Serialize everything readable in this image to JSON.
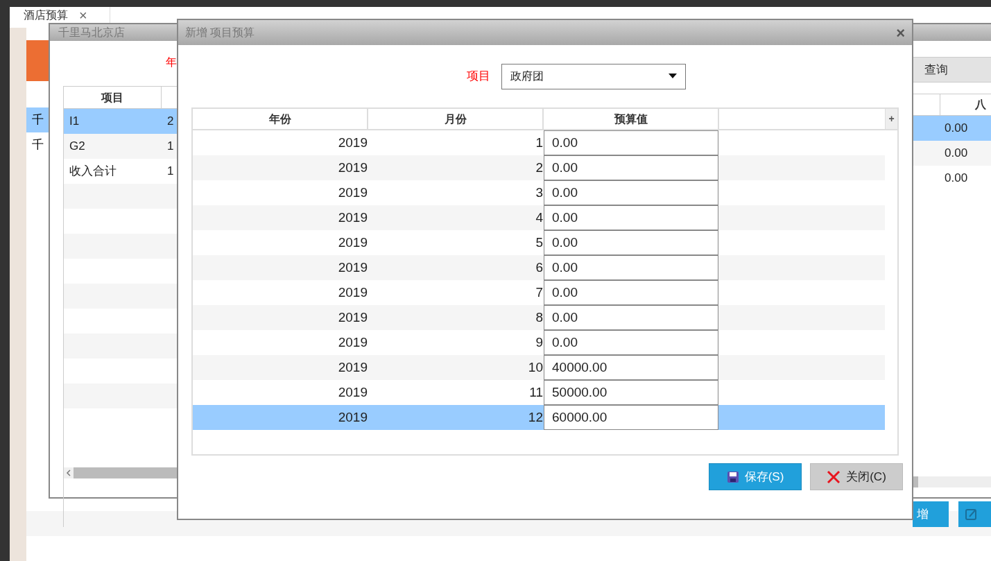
{
  "tab": {
    "label": "酒店预算",
    "close": "×"
  },
  "page": {
    "list_rows": [
      {
        "label": "千",
        "selected": true
      },
      {
        "label": "千",
        "selected": false
      }
    ]
  },
  "store_window": {
    "title": "千里马北京店",
    "year_label": "年",
    "query_button": "查询",
    "columns": [
      "项目"
    ],
    "right_column": "八",
    "rows": [
      {
        "cells": [
          "I1",
          "2"
        ],
        "right_value": "0.00",
        "selected": true
      },
      {
        "cells": [
          "G2",
          "1"
        ],
        "right_value": "0.00",
        "selected": false
      },
      {
        "cells": [
          "收入合计",
          "1"
        ],
        "right_value": "0.00",
        "selected": false
      }
    ],
    "add_button": "增"
  },
  "dialog": {
    "title": "新增 项目预算",
    "close": "×",
    "project_label": "项目",
    "project_value": "政府团",
    "columns": [
      "年份",
      "月份",
      "预算值"
    ],
    "add_column": "+",
    "rows": [
      {
        "year": "2019",
        "month": "1",
        "budget": "0.00",
        "selected": false
      },
      {
        "year": "2019",
        "month": "2",
        "budget": "0.00",
        "selected": false
      },
      {
        "year": "2019",
        "month": "3",
        "budget": "0.00",
        "selected": false
      },
      {
        "year": "2019",
        "month": "4",
        "budget": "0.00",
        "selected": false
      },
      {
        "year": "2019",
        "month": "5",
        "budget": "0.00",
        "selected": false
      },
      {
        "year": "2019",
        "month": "6",
        "budget": "0.00",
        "selected": false
      },
      {
        "year": "2019",
        "month": "7",
        "budget": "0.00",
        "selected": false
      },
      {
        "year": "2019",
        "month": "8",
        "budget": "0.00",
        "selected": false
      },
      {
        "year": "2019",
        "month": "9",
        "budget": "0.00",
        "selected": false
      },
      {
        "year": "2019",
        "month": "10",
        "budget": "40000.00",
        "selected": false
      },
      {
        "year": "2019",
        "month": "11",
        "budget": "50000.00",
        "selected": false
      },
      {
        "year": "2019",
        "month": "12",
        "budget": "60000.00",
        "selected": true
      }
    ],
    "buttons": [
      {
        "kind": "save",
        "label": "保存(S)"
      },
      {
        "kind": "close",
        "label": "关闭(C)"
      }
    ]
  }
}
